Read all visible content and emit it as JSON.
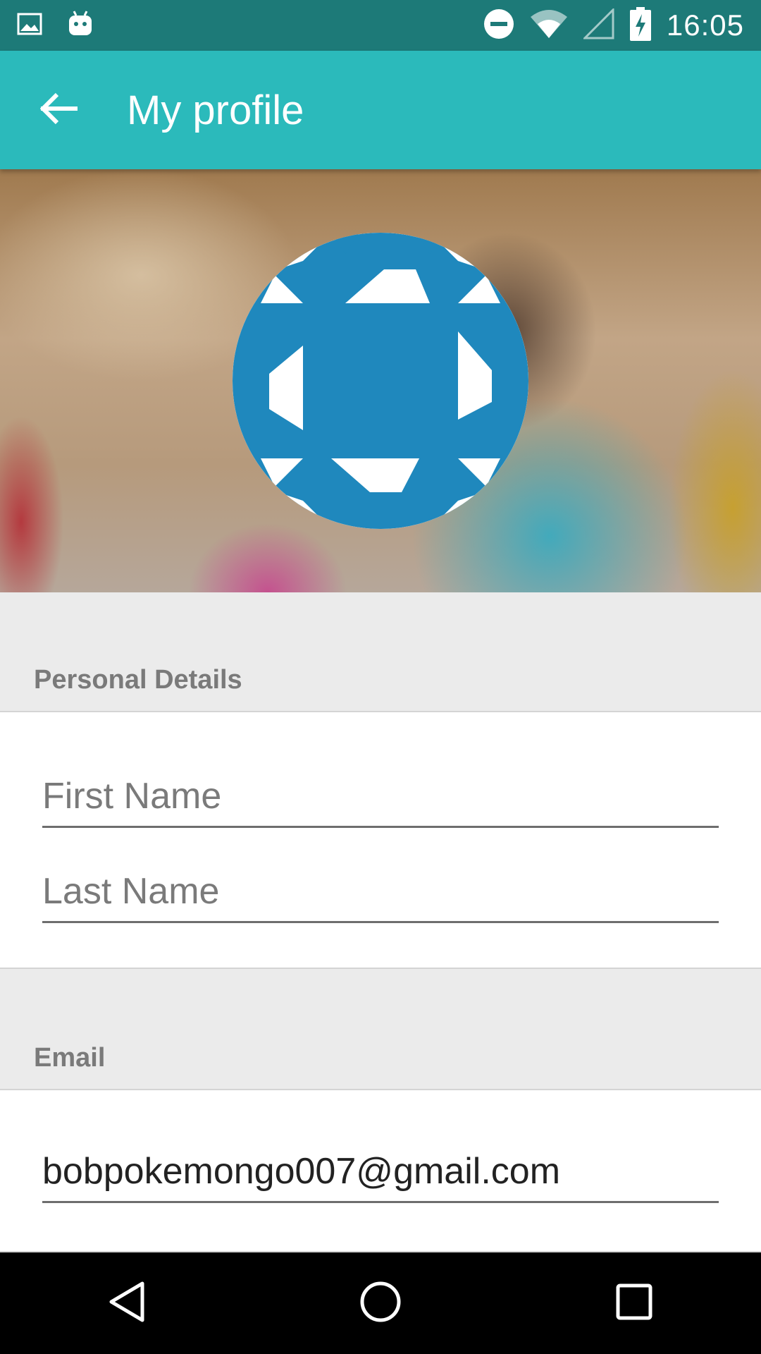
{
  "status_bar": {
    "time": "16:05",
    "icons_left": [
      "image-notification-icon",
      "android-notification-icon"
    ],
    "icons_right": [
      "do-not-disturb-icon",
      "wifi-icon",
      "cell-signal-icon",
      "battery-charging-icon"
    ]
  },
  "app_bar": {
    "title": "My profile",
    "background": "#2bbabb"
  },
  "profile": {
    "avatar_color": "#1f88bd"
  },
  "personal_details": {
    "header": "Personal Details",
    "first_name_placeholder": "First Name",
    "last_name_placeholder": "Last Name",
    "first_name_value": "",
    "last_name_value": ""
  },
  "email": {
    "header": "Email",
    "value": "bobpokemongo007@gmail.com"
  }
}
